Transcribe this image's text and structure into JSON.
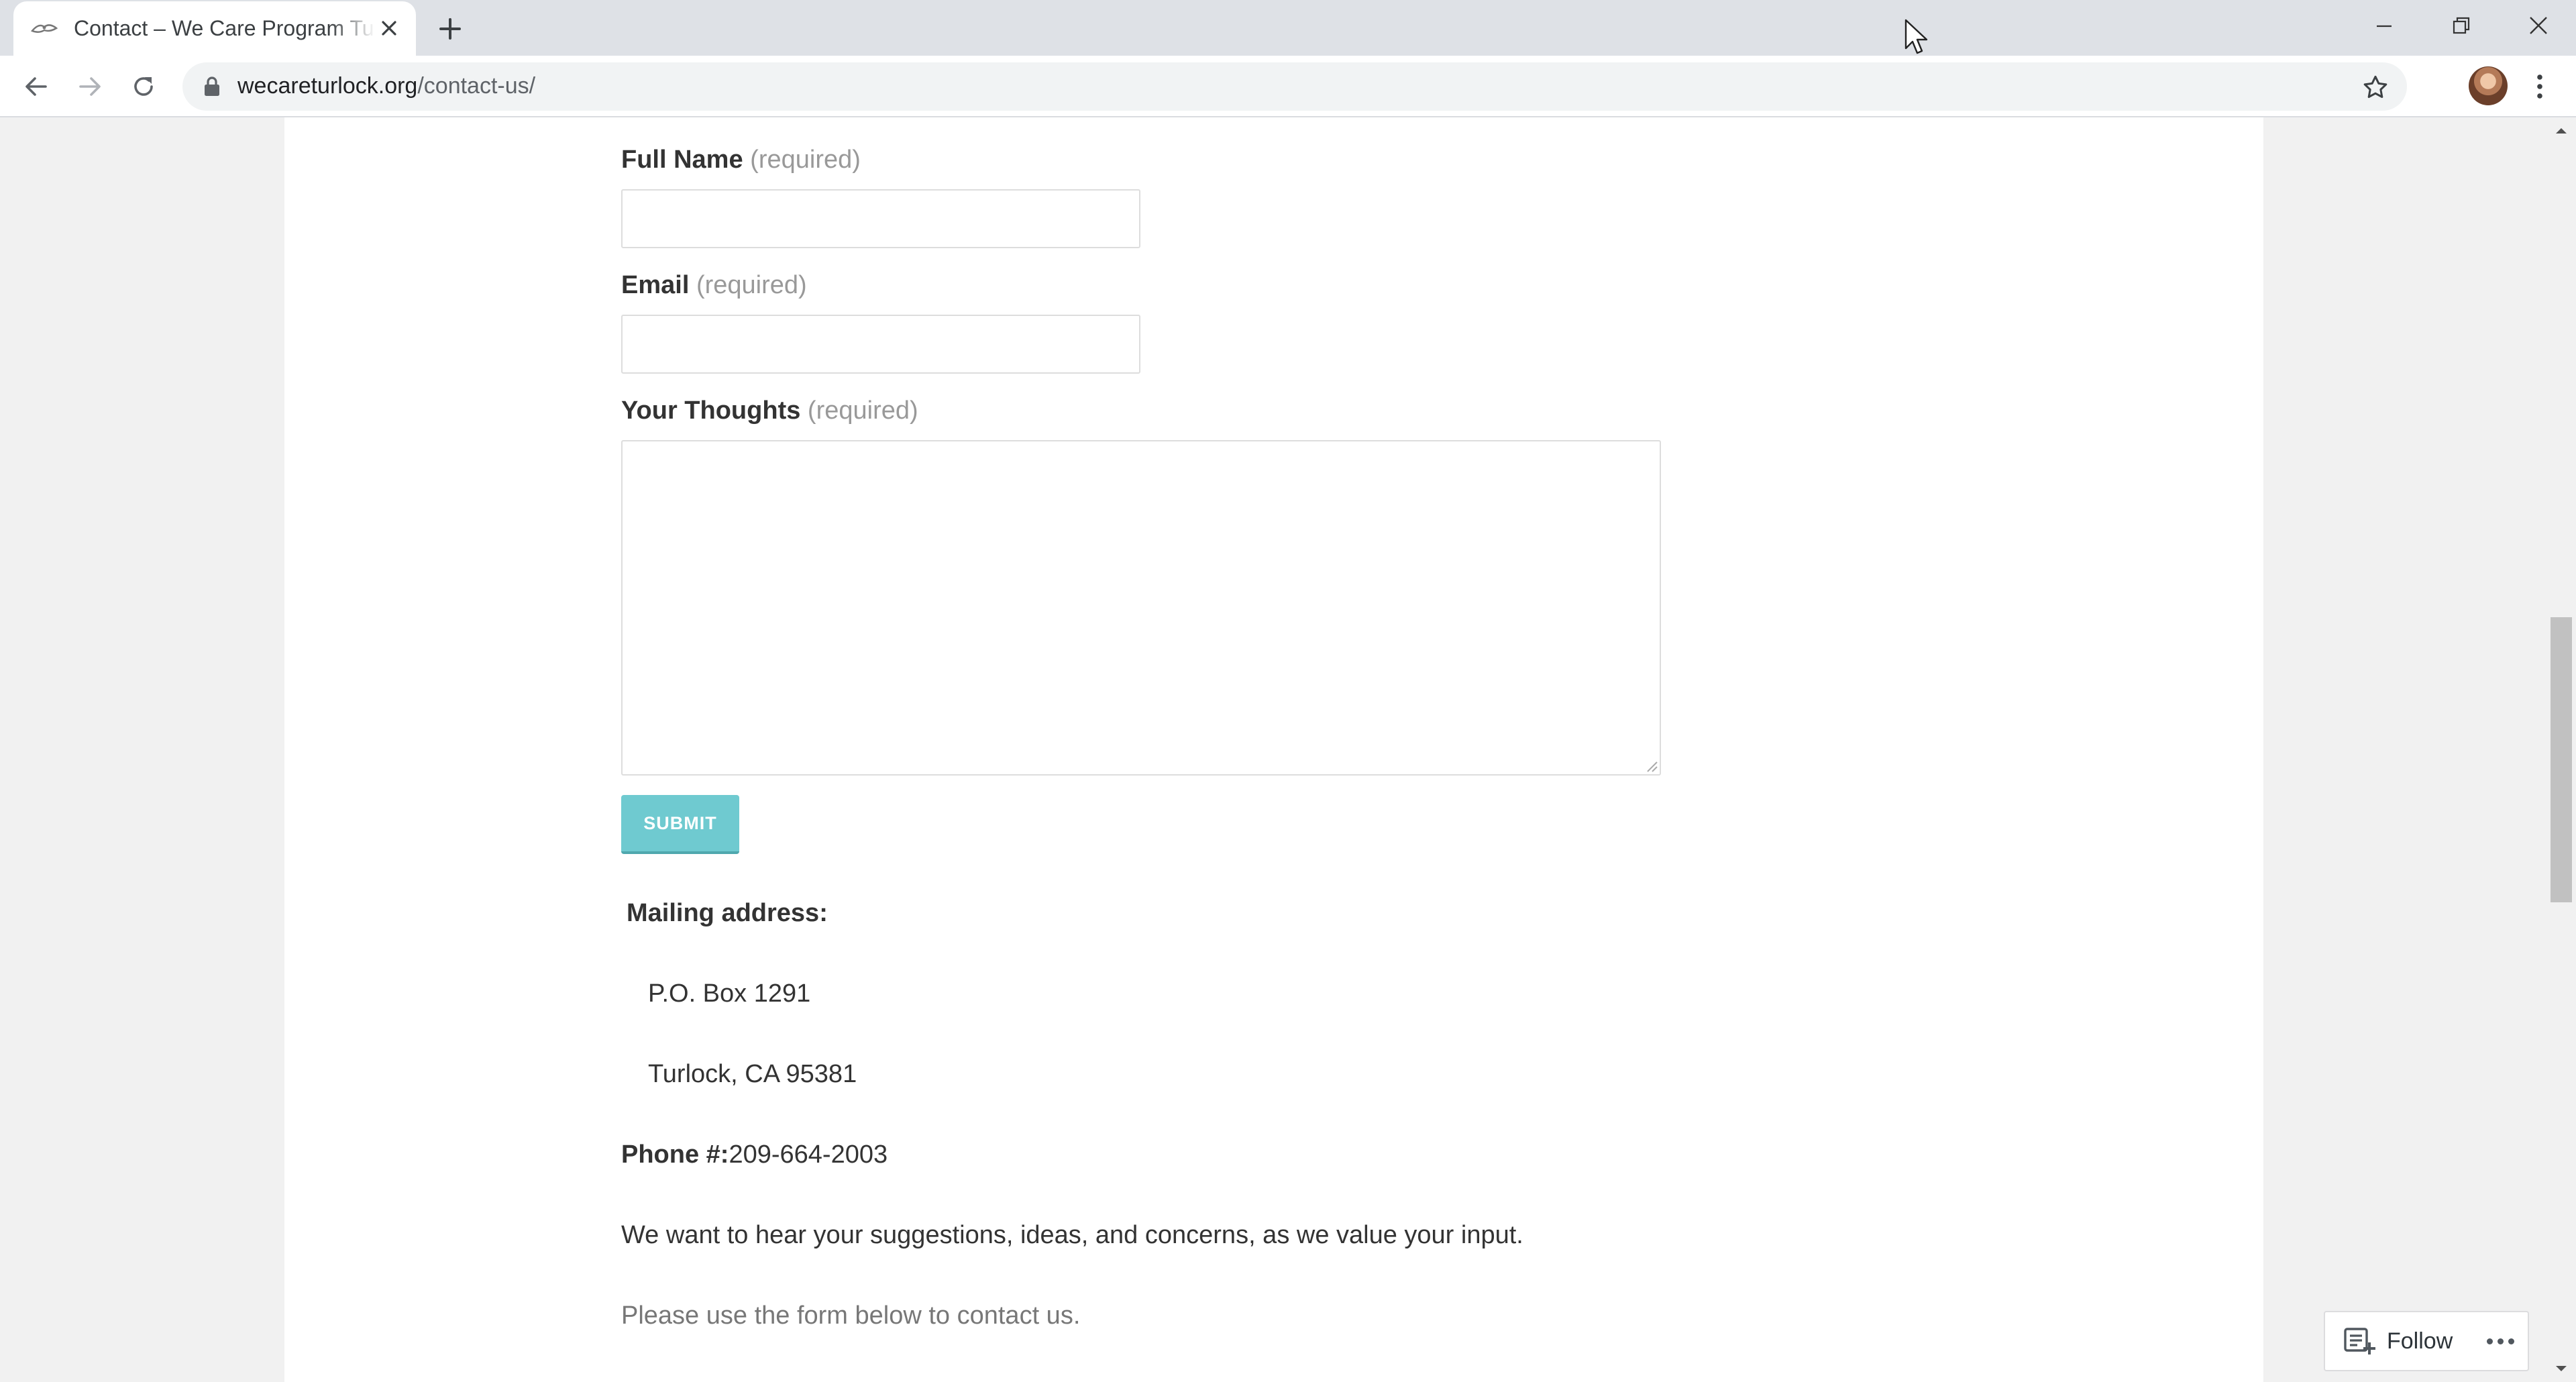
{
  "browser": {
    "tab_title": "Contact – We Care Program Turlock",
    "url_host": "wecareturlock.org",
    "url_path": "/contact-us/"
  },
  "form": {
    "full_name_label": "Full Name",
    "full_name_required": "(required)",
    "email_label": "Email",
    "email_required": "(required)",
    "thoughts_label": "Your Thoughts",
    "thoughts_required": "(required)",
    "submit_label": "SUBMIT"
  },
  "contact": {
    "mailing_heading": "Mailing address:",
    "po_box": "P.O. Box 1291",
    "city": "Turlock, CA 95381",
    "phone_label": "Phone #:",
    "phone_value": "209-664-2003",
    "message": "We want to hear your suggestions, ideas, and concerns, as we value your input.",
    "instruction": "Please use the form below to contact us."
  },
  "follow_widget": {
    "label": "Follow"
  },
  "colors": {
    "submit": "#6fcad0",
    "page_background": "#f1f1f1",
    "content_background": "#ffffff"
  }
}
